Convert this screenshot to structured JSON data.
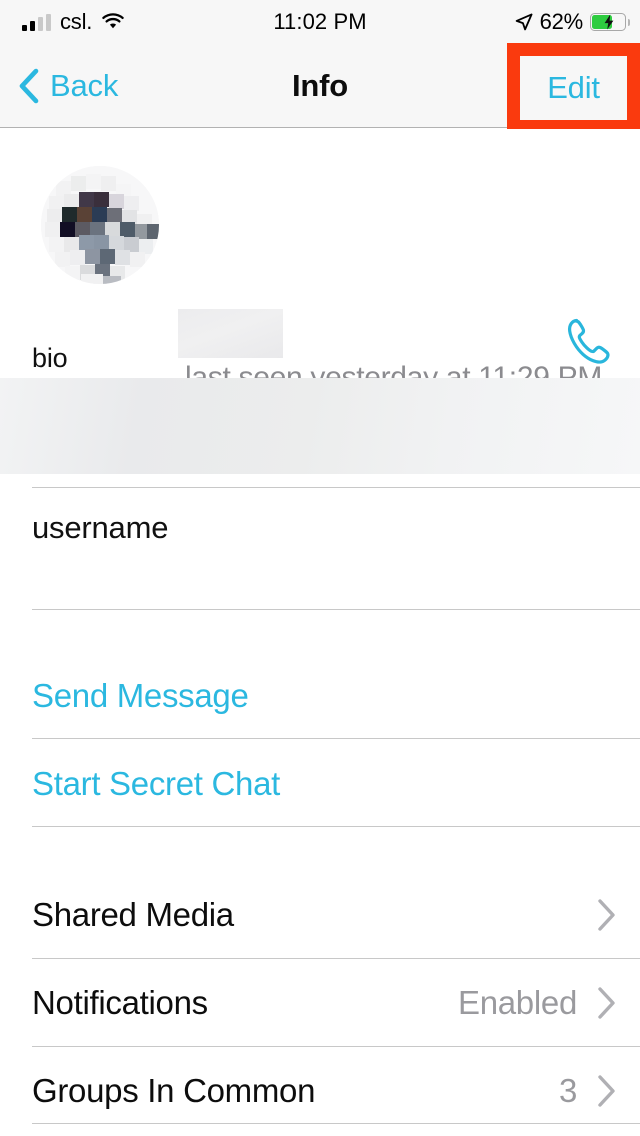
{
  "status_bar": {
    "carrier": "csl.",
    "time": "11:02 PM",
    "battery_percent": "62%",
    "signal_bars_filled": 2,
    "signal_bars_total": 4,
    "wifi_icon": "wifi-icon",
    "location_icon": "location-arrow-icon",
    "battery_icon": "battery-charging-icon",
    "battery_charging": true,
    "battery_fill_color": "#2ECC40"
  },
  "nav_bar": {
    "back_label": "Back",
    "back_icon": "chevron-left-icon",
    "title": "Info",
    "edit_label": "Edit",
    "highlight_color": "#FA3A0E",
    "accent_color": "#2BB8E0"
  },
  "profile": {
    "name": "",
    "name_redacted": true,
    "avatar_redacted": true,
    "status": "last seen yesterday at 11:29 PM",
    "call_icon": "phone-icon"
  },
  "sections": {
    "bio": {
      "label": "bio",
      "value": "",
      "value_redacted": true
    },
    "username": {
      "label": "username",
      "value": "",
      "value_redacted": true
    }
  },
  "actions": [
    {
      "label": "Send Message",
      "name": "send-message-link"
    },
    {
      "label": "Start Secret Chat",
      "name": "start-secret-chat-link"
    }
  ],
  "list_rows": [
    {
      "title": "Shared Media",
      "value": "",
      "chevron": "chevron-right-icon",
      "name": "shared-media-row"
    },
    {
      "title": "Notifications",
      "value": "Enabled",
      "chevron": "chevron-right-icon",
      "name": "notifications-row"
    },
    {
      "title": "Groups In Common",
      "value": "3",
      "chevron": "chevron-right-icon",
      "name": "groups-in-common-row"
    }
  ]
}
